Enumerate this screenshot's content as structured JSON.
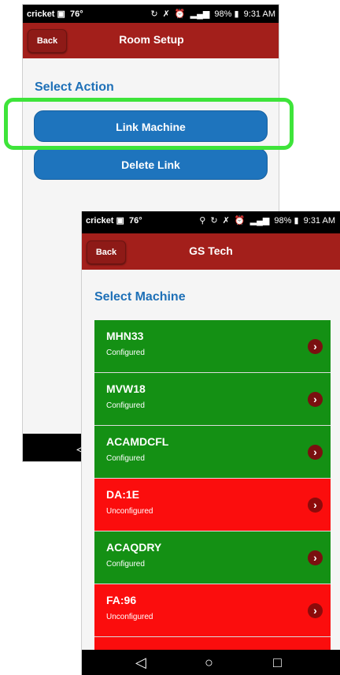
{
  "room_setup": {
    "status": {
      "carrier": "cricket",
      "temp": "76°",
      "battery": "98%",
      "time": "9:31 AM"
    },
    "back_label": "Back",
    "title": "Room Setup",
    "section_title": "Select Action",
    "link_machine_label": "Link Machine",
    "delete_link_label": "Delete Link"
  },
  "gs_tech": {
    "status": {
      "carrier": "cricket",
      "temp": "76°",
      "battery": "98%",
      "time": "9:31 AM"
    },
    "back_label": "Back",
    "title": "GS Tech",
    "section_title": "Select Machine",
    "machines": [
      {
        "name": "MHN33",
        "state": "Configured"
      },
      {
        "name": "MVW18",
        "state": "Configured"
      },
      {
        "name": "ACAMDCFL",
        "state": "Configured"
      },
      {
        "name": "DA:1E",
        "state": "Unconfigured"
      },
      {
        "name": "ACAQDRY",
        "state": "Configured"
      },
      {
        "name": "FA:96",
        "state": "Unconfigured"
      },
      {
        "name": "",
        "state": ""
      }
    ]
  },
  "colors": {
    "appbar": "#a31f1b",
    "accent_blue": "#1e74bd",
    "configured": "#149014",
    "unconfigured": "#fb0d0d",
    "highlight": "#3ee43a"
  },
  "icons": {
    "chevron": "chevron-right-icon",
    "nav_back": "back-triangle-icon",
    "nav_home": "home-circle-icon",
    "nav_recent": "recent-square-icon"
  }
}
